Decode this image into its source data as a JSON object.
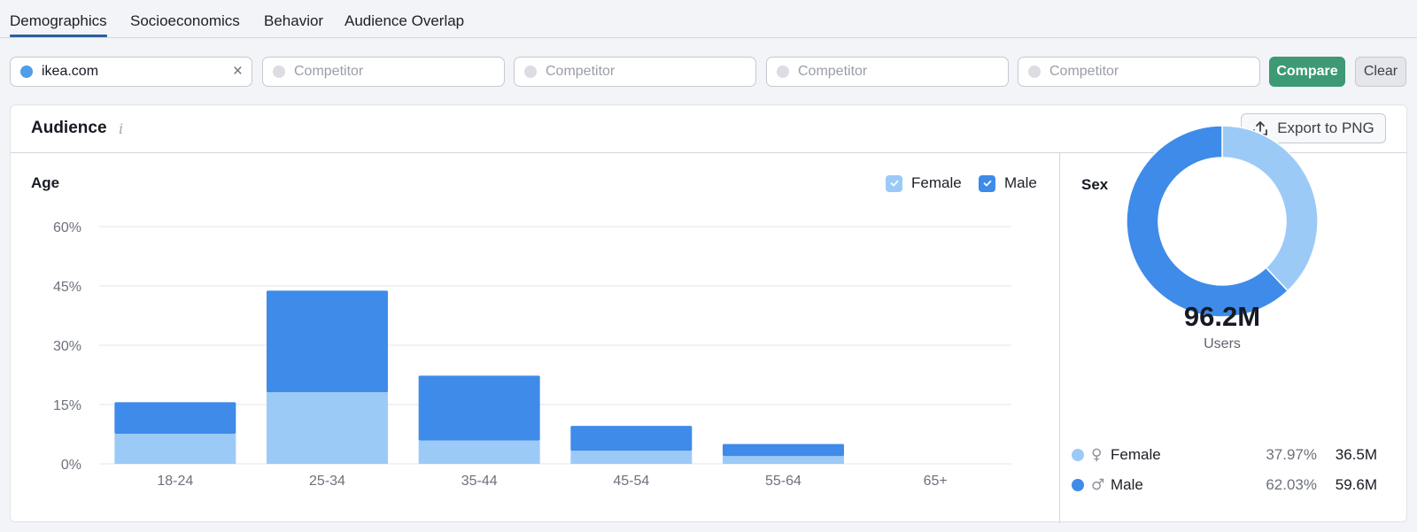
{
  "tabs": [
    {
      "label": "Demographics",
      "active": true
    },
    {
      "label": "Socioeconomics",
      "active": false
    },
    {
      "label": "Behavior",
      "active": false
    },
    {
      "label": "Audience Overlap",
      "active": false
    }
  ],
  "domains": [
    {
      "value": "ikea.com",
      "placeholder": "",
      "dot_color": "#4f9ee8"
    },
    {
      "value": "",
      "placeholder": "Competitor",
      "dot_color": "#dcdde2"
    },
    {
      "value": "",
      "placeholder": "Competitor",
      "dot_color": "#dcdde2"
    },
    {
      "value": "",
      "placeholder": "Competitor",
      "dot_color": "#dcdde2"
    },
    {
      "value": "",
      "placeholder": "Competitor",
      "dot_color": "#dcdde2"
    }
  ],
  "buttons": {
    "compare": "Compare",
    "clear": "Clear",
    "clear_icon": "×",
    "export": "Export to PNG"
  },
  "card": {
    "title": "Audience",
    "info_icon": "i"
  },
  "age": {
    "title": "Age",
    "legend": [
      {
        "label": "Female",
        "checked": true,
        "color": "#9ccaf7"
      },
      {
        "label": "Male",
        "checked": true,
        "color": "#3e8bea"
      }
    ]
  },
  "sex": {
    "title": "Sex",
    "total": "96.2M",
    "total_label": "Users",
    "rows": [
      {
        "label": "Female",
        "icon": "♀",
        "percent": "37.97%",
        "count": "36.5M",
        "color": "#9ccaf7"
      },
      {
        "label": "Male",
        "icon": "♂",
        "percent": "62.03%",
        "count": "59.6M",
        "color": "#3e8bea"
      }
    ]
  },
  "colors": {
    "female": "#9ccaf7",
    "male": "#3e8bea",
    "accent_green": "#3d9a74",
    "tab_underline": "#2e5f9e"
  },
  "chart_data": [
    {
      "type": "bar",
      "stacked": true,
      "title": "Age",
      "xlabel": "",
      "ylabel": "",
      "categories": [
        "18-24",
        "25-34",
        "35-44",
        "45-54",
        "55-64",
        "65+"
      ],
      "series": [
        {
          "name": "Female",
          "values": [
            7.6,
            18.1,
            5.9,
            3.3,
            2.0,
            0
          ]
        },
        {
          "name": "Male",
          "values": [
            8.0,
            25.7,
            16.4,
            6.3,
            3.0,
            0
          ]
        }
      ],
      "yticks": [
        "0%",
        "15%",
        "30%",
        "45%",
        "60%"
      ],
      "ylim": [
        0,
        60
      ],
      "grid": true,
      "legend": "top-right"
    },
    {
      "type": "pie",
      "donut": true,
      "title": "Sex",
      "categories": [
        "Female",
        "Male"
      ],
      "values": [
        37.97,
        62.03
      ],
      "center_label": "96.2M Users"
    }
  ]
}
